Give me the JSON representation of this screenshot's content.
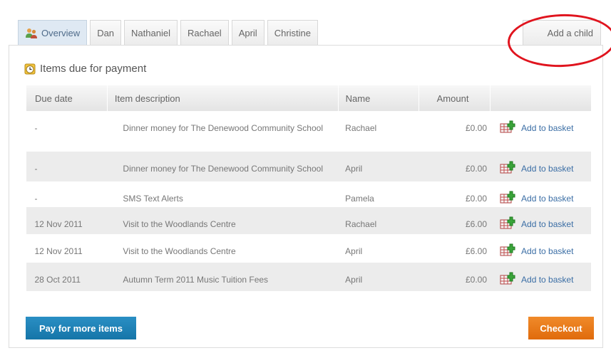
{
  "tabs": [
    {
      "label": "Overview",
      "icon": "people-icon",
      "active": true
    },
    {
      "label": "Dan"
    },
    {
      "label": "Nathaniel"
    },
    {
      "label": "Rachael"
    },
    {
      "label": "April"
    },
    {
      "label": "Christine"
    }
  ],
  "add_child": {
    "label": "Add a child",
    "highlight_color": "#e0141e"
  },
  "section": {
    "title": "Items due for payment",
    "icon": "clock-icon"
  },
  "table": {
    "headers": {
      "due_date": "Due date",
      "description": "Item description",
      "name": "Name",
      "amount": "Amount"
    },
    "rows": [
      {
        "due_date": "-",
        "description": "Dinner money for The Denewood Community School",
        "name": "Rachael",
        "amount": "£0.00",
        "action": "Add to basket"
      },
      {
        "due_date": "-",
        "description": "Dinner money for The Denewood Community School",
        "name": "April",
        "amount": "£0.00",
        "action": "Add to basket"
      },
      {
        "due_date": "-",
        "description": "SMS Text Alerts",
        "name": "Pamela",
        "amount": "£0.00",
        "action": "Add to basket"
      },
      {
        "due_date": "12 Nov 2011",
        "description": "Visit to the Woodlands Centre",
        "name": "Rachael",
        "amount": "£6.00",
        "action": "Add to basket"
      },
      {
        "due_date": "12 Nov 2011",
        "description": "Visit to the Woodlands Centre",
        "name": "April",
        "amount": "£6.00",
        "action": "Add to basket"
      },
      {
        "due_date": "28 Oct 2011",
        "description": "Autumn Term 2011 Music Tuition Fees",
        "name": "April",
        "amount": "£0.00",
        "action": "Add to basket"
      }
    ]
  },
  "buttons": {
    "pay_more": {
      "label": "Pay for more items",
      "color": "#1a7fb5"
    },
    "checkout": {
      "label": "Checkout",
      "color": "#e8740f"
    }
  }
}
